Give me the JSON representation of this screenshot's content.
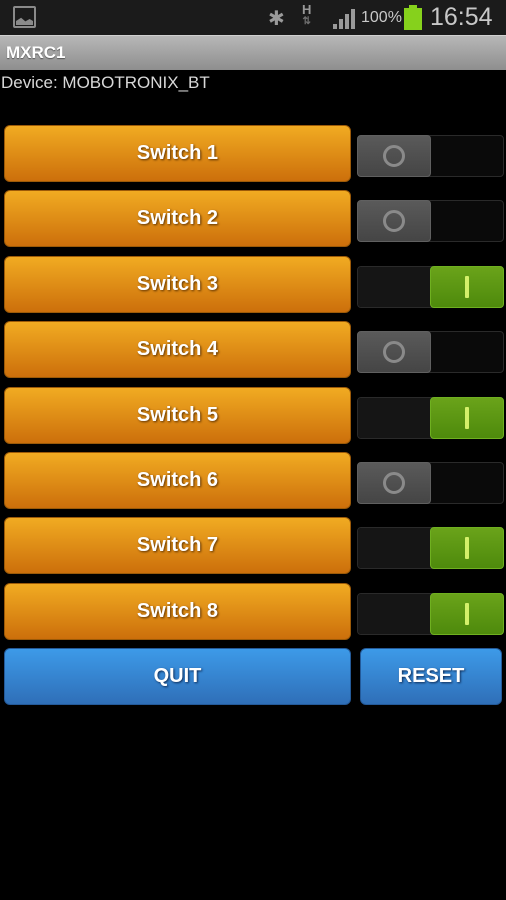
{
  "status_bar": {
    "battery_percent": "100%",
    "time": "16:54",
    "network_type": "H",
    "icons": [
      "gallery-icon",
      "bluetooth-icon",
      "hspa-data-icon",
      "signal-icon",
      "battery-icon"
    ],
    "battery_color": "#86d11c"
  },
  "app": {
    "title": "MXRC1",
    "device_label": "Device: MOBOTRONIX_BT"
  },
  "switches": [
    {
      "label": "Switch 1",
      "on": false
    },
    {
      "label": "Switch 2",
      "on": false
    },
    {
      "label": "Switch 3",
      "on": true
    },
    {
      "label": "Switch 4",
      "on": false
    },
    {
      "label": "Switch 5",
      "on": true
    },
    {
      "label": "Switch 6",
      "on": false
    },
    {
      "label": "Switch 7",
      "on": true
    },
    {
      "label": "Switch 8",
      "on": true
    }
  ],
  "actions": {
    "quit_label": "QUIT",
    "reset_label": "RESET"
  },
  "colors": {
    "switch_button": "#e08c15",
    "toggle_on": "#5c9a12",
    "toggle_off": "#4f4f4f",
    "action_button": "#3a86d4"
  }
}
